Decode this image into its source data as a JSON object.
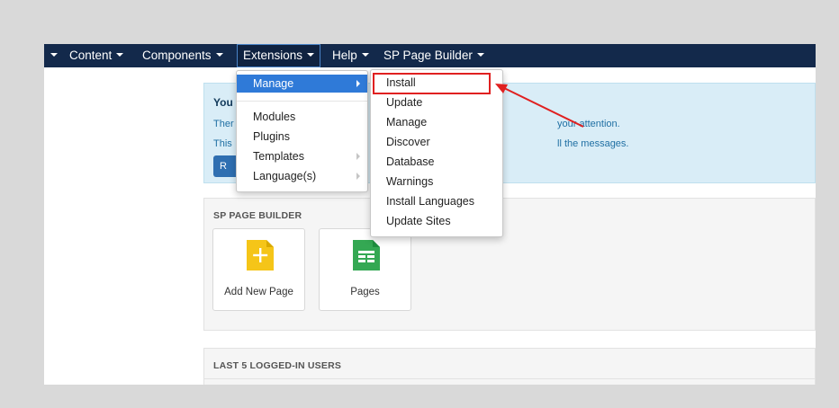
{
  "navbar": {
    "items": [
      {
        "label": ""
      },
      {
        "label": "Content"
      },
      {
        "label": "Components"
      },
      {
        "label": "Extensions"
      },
      {
        "label": "Help"
      },
      {
        "label": "SP Page Builder"
      }
    ]
  },
  "alert": {
    "title_fragment": "You",
    "line1_left": "Ther",
    "line1_right": "your attention.",
    "line2_left": "This",
    "line2_right": "ll the messages.",
    "button_fragment": "R"
  },
  "extensions_menu": {
    "items": [
      {
        "label": "Manage"
      },
      {
        "label": "Modules"
      },
      {
        "label": "Plugins"
      },
      {
        "label": "Templates"
      },
      {
        "label": "Language(s)"
      }
    ]
  },
  "manage_submenu": {
    "items": [
      {
        "label": "Install"
      },
      {
        "label": "Update"
      },
      {
        "label": "Manage"
      },
      {
        "label": "Discover"
      },
      {
        "label": "Database"
      },
      {
        "label": "Warnings"
      },
      {
        "label": "Install Languages"
      },
      {
        "label": "Update Sites"
      }
    ]
  },
  "sp_panel": {
    "title": "SP PAGE BUILDER",
    "tiles": [
      {
        "label": "Add New Page",
        "icon": "add-page-icon"
      },
      {
        "label": "Pages",
        "icon": "pages-icon"
      }
    ]
  },
  "users_panel": {
    "title": "LAST 5 LOGGED-IN USERS"
  },
  "colors": {
    "navbar": "#13294b",
    "alert_bg": "#d9edf7",
    "active_item": "#2f7ad8",
    "annotation": "#e02020",
    "add_icon": "#f5c518",
    "pages_icon": "#34a853"
  }
}
